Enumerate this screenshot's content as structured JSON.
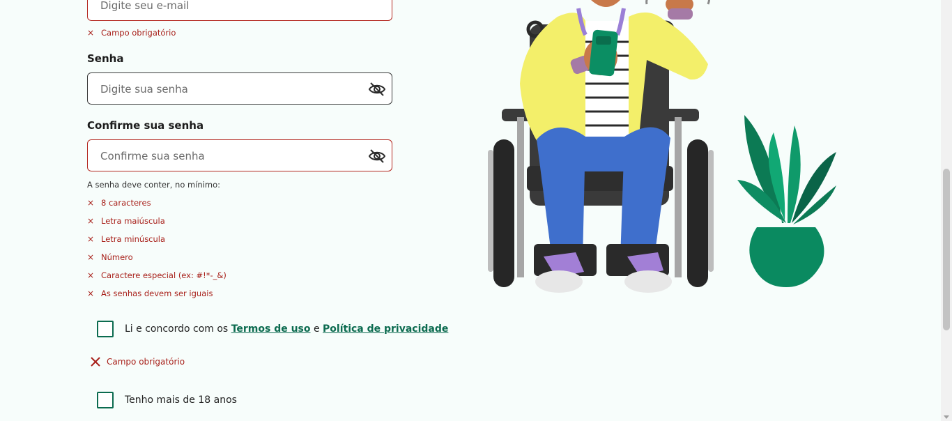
{
  "form": {
    "email": {
      "placeholder": "Digite seu e-mail",
      "error": "Campo obrigatório"
    },
    "password": {
      "label": "Senha",
      "placeholder": "Digite sua senha"
    },
    "confirm": {
      "label": "Confirme sua senha",
      "placeholder": "Confirme sua senha"
    },
    "hint": "A senha deve conter, no mínimo:",
    "requirements": [
      "8 caracteres",
      "Letra maiúscula",
      "Letra minúscula",
      "Número",
      "Caractere especial (ex: #!*-_&)",
      "As senhas devem ser iguais"
    ],
    "terms": {
      "prefix": "Li e concordo com os",
      "terms_link": "Termos de uso",
      "and": "e",
      "privacy_link": "Política de privacidade",
      "error": "Campo obrigatório"
    },
    "age": {
      "label": "Tenho mais de 18 anos"
    }
  },
  "colors": {
    "background": "#f7fdfb",
    "error": "#a8201a",
    "brand_green": "#0b6b4f"
  },
  "icons": {
    "error_mark": "×",
    "password_toggle": "eye-off-icon"
  },
  "illustration": "person-in-wheelchair-with-phone-and-plant"
}
